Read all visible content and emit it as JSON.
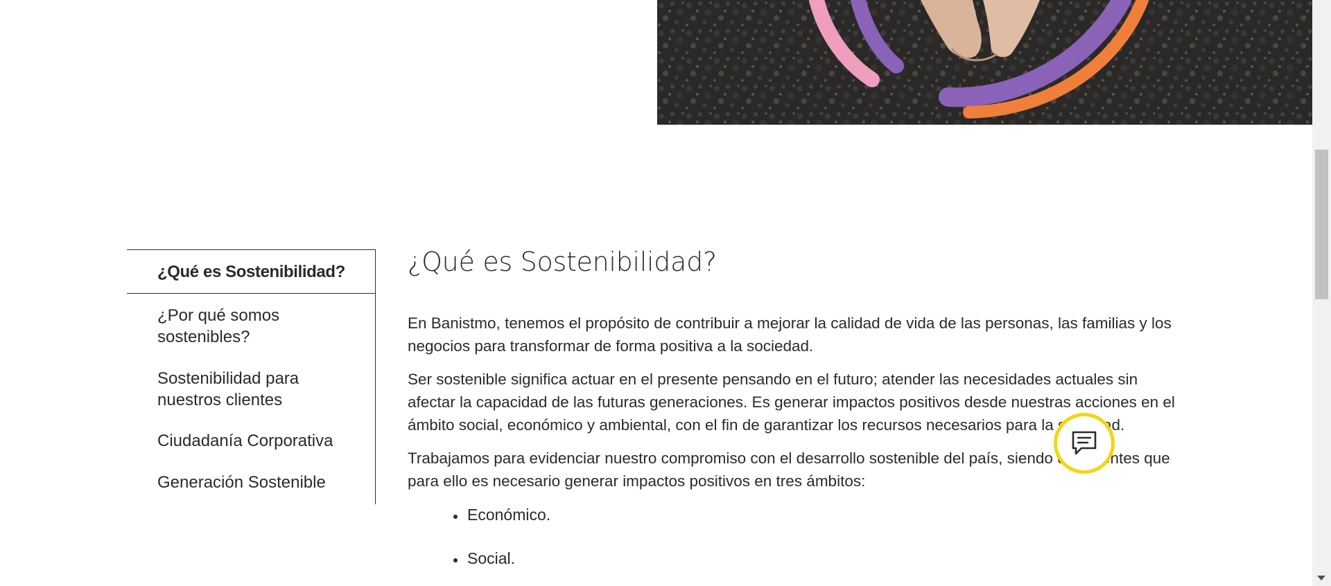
{
  "hero": {
    "image_alt": "Manos sobre tierra con arcos de colores",
    "arc_colors": {
      "pink": "#f09ec0",
      "purple": "#8a62b8",
      "orange": "#f07f3c"
    }
  },
  "side_nav": {
    "items": [
      {
        "label": "¿Qué es Sostenibilidad?",
        "active": true
      },
      {
        "label": "¿Por qué somos sostenibles?",
        "active": false
      },
      {
        "label": "Sostenibilidad para nuestros clientes",
        "active": false
      },
      {
        "label": "Ciudadanía Corporativa",
        "active": false
      },
      {
        "label": "Generación Sostenible",
        "active": false
      }
    ]
  },
  "main": {
    "title": "¿Qué es Sostenibilidad?",
    "paragraphs": [
      "En Banistmo, tenemos el propósito de contribuir a mejorar la calidad de vida de las personas, las familias y los negocios para transformar de forma positiva a la sociedad.",
      "Ser sostenible significa actuar en el presente pensando en el futuro; atender las necesidades actuales sin afectar la capacidad de las futuras generaciones. Es generar impactos positivos desde nuestras acciones en el ámbito social, económico y ambiental, con el fin de garantizar los recursos necesarios para la sociedad.",
      "Trabajamos para evidenciar nuestro compromiso con el desarrollo sostenible del país, siendo conscientes que para ello es necesario generar impactos positivos en tres ámbitos:"
    ],
    "list": [
      "Económico.",
      "Social."
    ]
  },
  "chat": {
    "icon": "chat-bubble-icon",
    "ring_color": "#f5d50d"
  }
}
